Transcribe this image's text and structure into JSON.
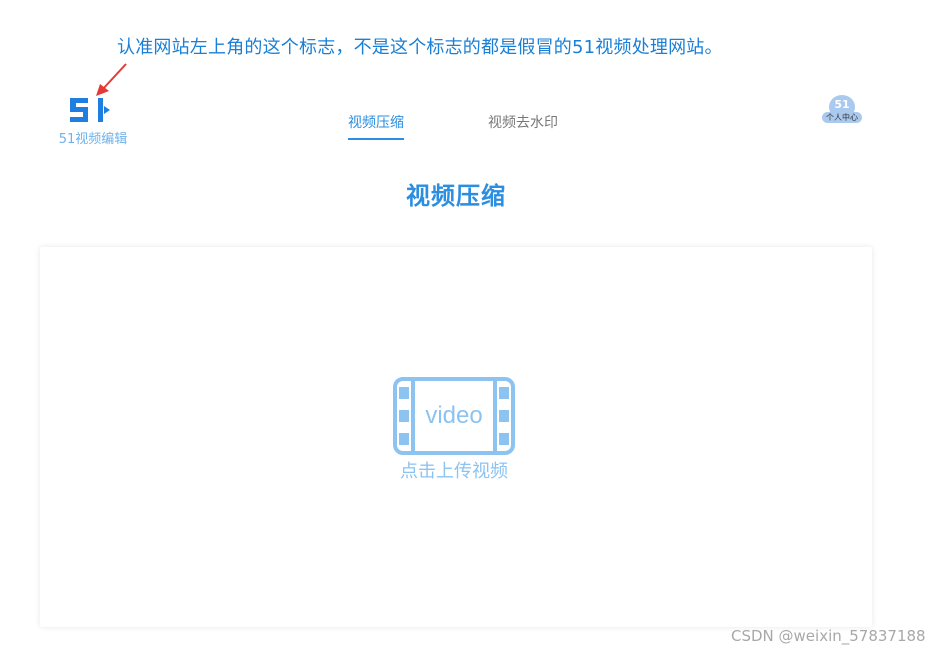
{
  "annotation": {
    "text": "认准网站左上角的这个标志，不是这个标志的都是假冒的51视频处理网站。"
  },
  "logo": {
    "mark": "51",
    "text": "51视频编辑"
  },
  "nav": {
    "tabs": [
      {
        "label": "视频压缩",
        "active": true
      },
      {
        "label": "视频去水印",
        "active": false
      }
    ]
  },
  "user": {
    "avatar_text": "51",
    "label": "个人中心"
  },
  "page": {
    "title": "视频压缩"
  },
  "upload": {
    "icon_text": "video",
    "label": "点击上传视频"
  },
  "watermark": {
    "text": "CSDN @weixin_57837188"
  },
  "colors": {
    "primary": "#2b8ee0",
    "light_blue": "#8cc3f0",
    "annotation": "#1a7fd6",
    "arrow": "#e53935"
  }
}
